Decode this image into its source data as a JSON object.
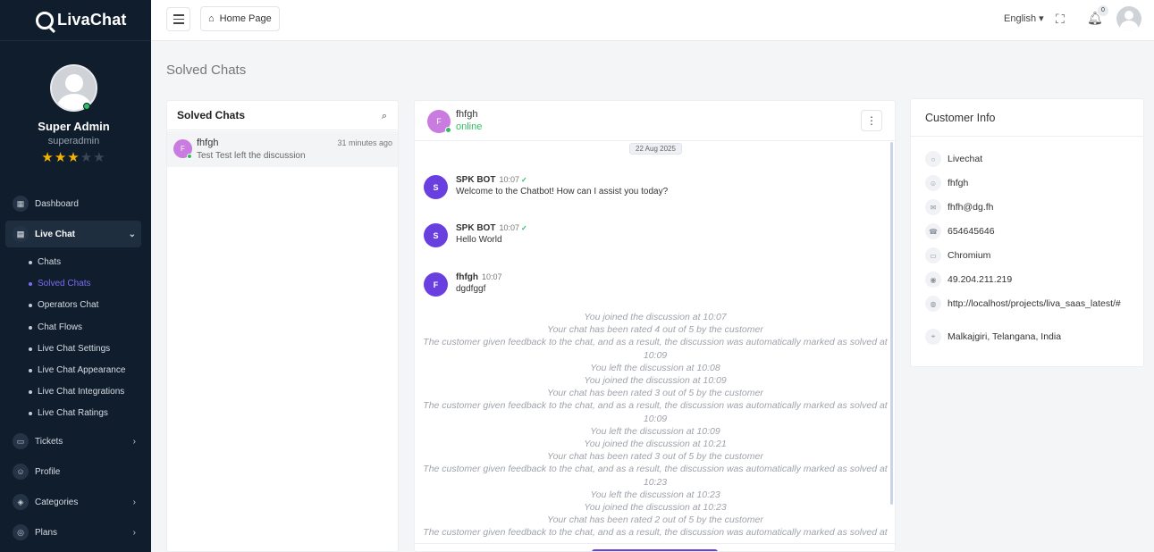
{
  "brand": {
    "name": "LivaChat"
  },
  "profile": {
    "name": "Super Admin",
    "role": "superadmin",
    "rating": 3,
    "rating_max": 5
  },
  "sidebar": {
    "items": [
      {
        "label": "Dashboard",
        "icon": "dashboard-icon"
      },
      {
        "label": "Live Chat",
        "icon": "chat-icon"
      },
      {
        "label": "Tickets",
        "icon": "ticket-icon"
      },
      {
        "label": "Profile",
        "icon": "user-icon"
      },
      {
        "label": "Categories",
        "icon": "categories-icon"
      },
      {
        "label": "Plans",
        "icon": "plans-icon"
      }
    ],
    "sub_items": [
      "Chats",
      "Solved Chats",
      "Operators Chat",
      "Chat Flows",
      "Live Chat Settings",
      "Live Chat Appearance",
      "Live Chat Integrations",
      "Live Chat Ratings"
    ]
  },
  "topbar": {
    "home_label": "Home Page",
    "language": "English",
    "notif_count": "0"
  },
  "page": {
    "title": "Solved Chats"
  },
  "list": {
    "title": "Solved Chats",
    "rows": [
      {
        "initial": "F",
        "name": "fhfgh",
        "preview": "Test Test left the discussion",
        "time": "31 minutes ago"
      }
    ]
  },
  "chat": {
    "initial": "F",
    "name": "fhfgh",
    "status": "online",
    "date": "22 Aug 2025",
    "messages": [
      {
        "initial": "S",
        "name": "SPK BOT",
        "time": "10:07",
        "text": "Welcome to the Chatbot! How can I assist you today?"
      },
      {
        "initial": "S",
        "name": "SPK BOT",
        "time": "10:07",
        "text": "Hello World"
      },
      {
        "initial": "F",
        "name": "fhfgh",
        "time": "10:07",
        "text": "dgdfggf"
      }
    ],
    "events": [
      "You joined the discussion at 10:07",
      "Your chat has been rated 4 out of 5 by the customer",
      "The customer given feedback to the chat, and as a result, the discussion was automatically marked as solved at 10:09",
      "You left the discussion at 10:08",
      "You joined the discussion at 10:09",
      "Your chat has been rated 3 out of 5 by the customer",
      "The customer given feedback to the chat, and as a result, the discussion was automatically marked as solved at 10:09",
      "You left the discussion at 10:09",
      "You joined the discussion at 10:21",
      "Your chat has been rated 3 out of 5 by the customer",
      "The customer given feedback to the chat, and as a result, the discussion was automatically marked as solved at 10:23",
      "You left the discussion at 10:23",
      "You joined the discussion at 10:23",
      "Your chat has been rated 2 out of 5 by the customer",
      "The customer given feedback to the chat, and as a result, the discussion was automatically marked as solved at"
    ]
  },
  "customer": {
    "title": "Customer Info",
    "fields": [
      {
        "icon": "chat-bubble-icon",
        "value": "Livechat"
      },
      {
        "icon": "user-icon",
        "value": "fhfgh"
      },
      {
        "icon": "mail-icon",
        "value": "fhfh@dg.fh"
      },
      {
        "icon": "phone-icon",
        "value": "654645646"
      },
      {
        "icon": "monitor-icon",
        "value": "Chromium"
      },
      {
        "icon": "location-pin-icon",
        "value": "49.204.211.219"
      },
      {
        "icon": "globe-icon",
        "value": "http://localhost/projects/liva_saas_latest/#"
      },
      {
        "icon": "map-pin-icon",
        "value": "Malkajgiri, Telangana, India"
      }
    ]
  },
  "colors": {
    "sidebar_bg": "#0f1d2c",
    "accent": "#6a3fe0",
    "online": "#2dbe60",
    "active_sub": "#7c6cf0"
  }
}
